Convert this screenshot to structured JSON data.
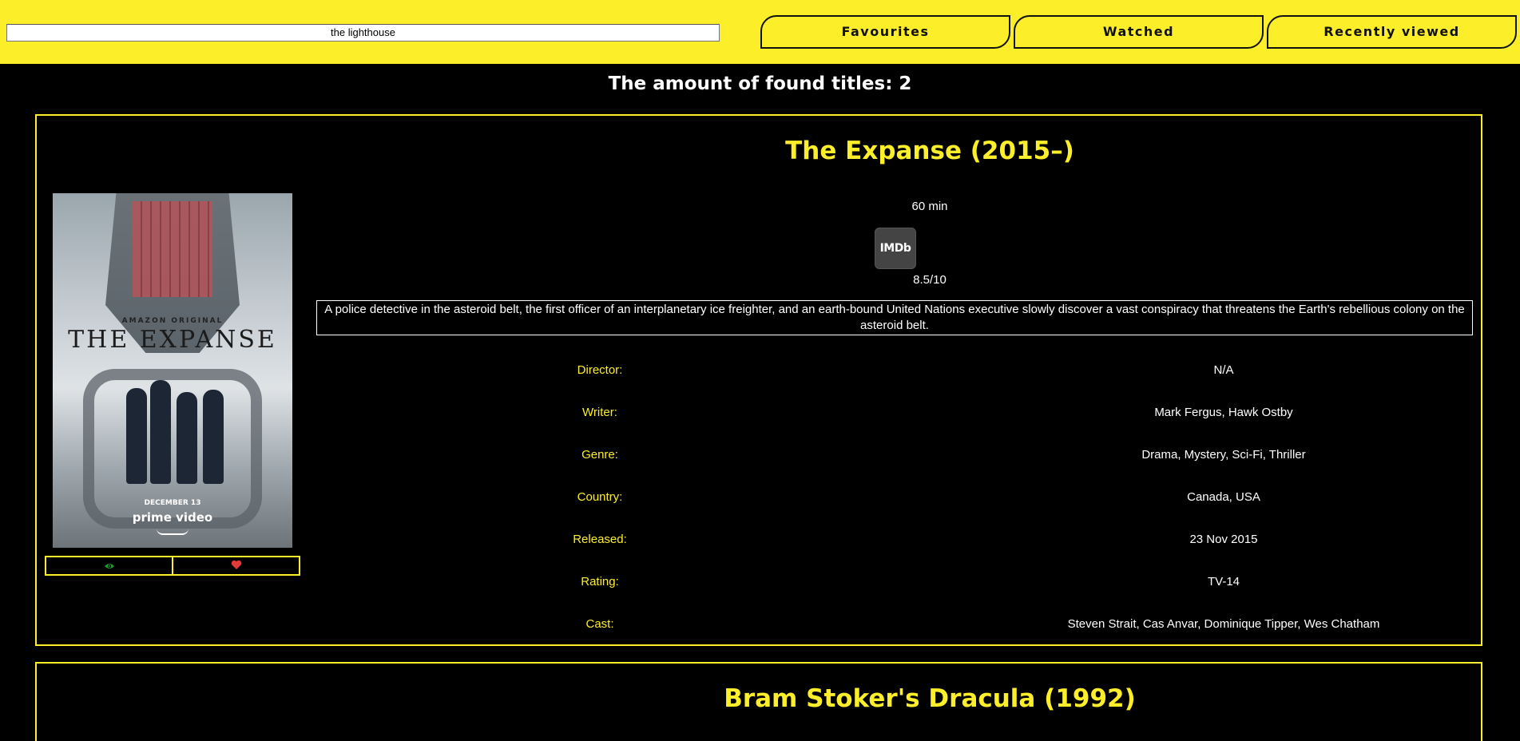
{
  "search": {
    "value": "the lighthouse"
  },
  "nav": {
    "favourites": "Favourites",
    "watched": "Watched",
    "recently_viewed": "Recently viewed"
  },
  "results": {
    "count_text": "The amount of found titles: 2",
    "items": [
      {
        "title": "The Expanse (2015–)",
        "runtime": "60 min",
        "imdb_logo": "IMDb",
        "imdb_rating": "8.5/10",
        "plot": "A police detective in the asteroid belt, the first officer of an interplanetary ice freighter, and an earth-bound United Nations executive slowly discover a vast conspiracy that threatens the Earth's rebellious colony on the asteroid belt.",
        "poster": {
          "top_text": "AMAZON ORIGINAL",
          "title_text": "THE EXPANSE",
          "date_text": "DECEMBER 13",
          "brand_text": "prime video"
        },
        "actions": {
          "watched_icon": "eye-icon",
          "watched_color": "#1aa12a",
          "favourite_icon": "heart-icon",
          "favourite_color": "#e03a3a"
        },
        "details": [
          {
            "label": "Director:",
            "value": "N/A"
          },
          {
            "label": "Writer:",
            "value": "Mark Fergus, Hawk Ostby"
          },
          {
            "label": "Genre:",
            "value": "Drama, Mystery, Sci-Fi, Thriller"
          },
          {
            "label": "Country:",
            "value": "Canada, USA"
          },
          {
            "label": "Released:",
            "value": "23 Nov 2015"
          },
          {
            "label": "Rating:",
            "value": "TV-14"
          },
          {
            "label": "Cast:",
            "value": "Steven Strait, Cas Anvar, Dominique Tipper, Wes Chatham"
          }
        ]
      },
      {
        "title": "Bram Stoker's Dracula (1992)"
      }
    ]
  },
  "colors": {
    "accent": "#fdee2a",
    "background": "#000000",
    "text": "#ffffff"
  }
}
